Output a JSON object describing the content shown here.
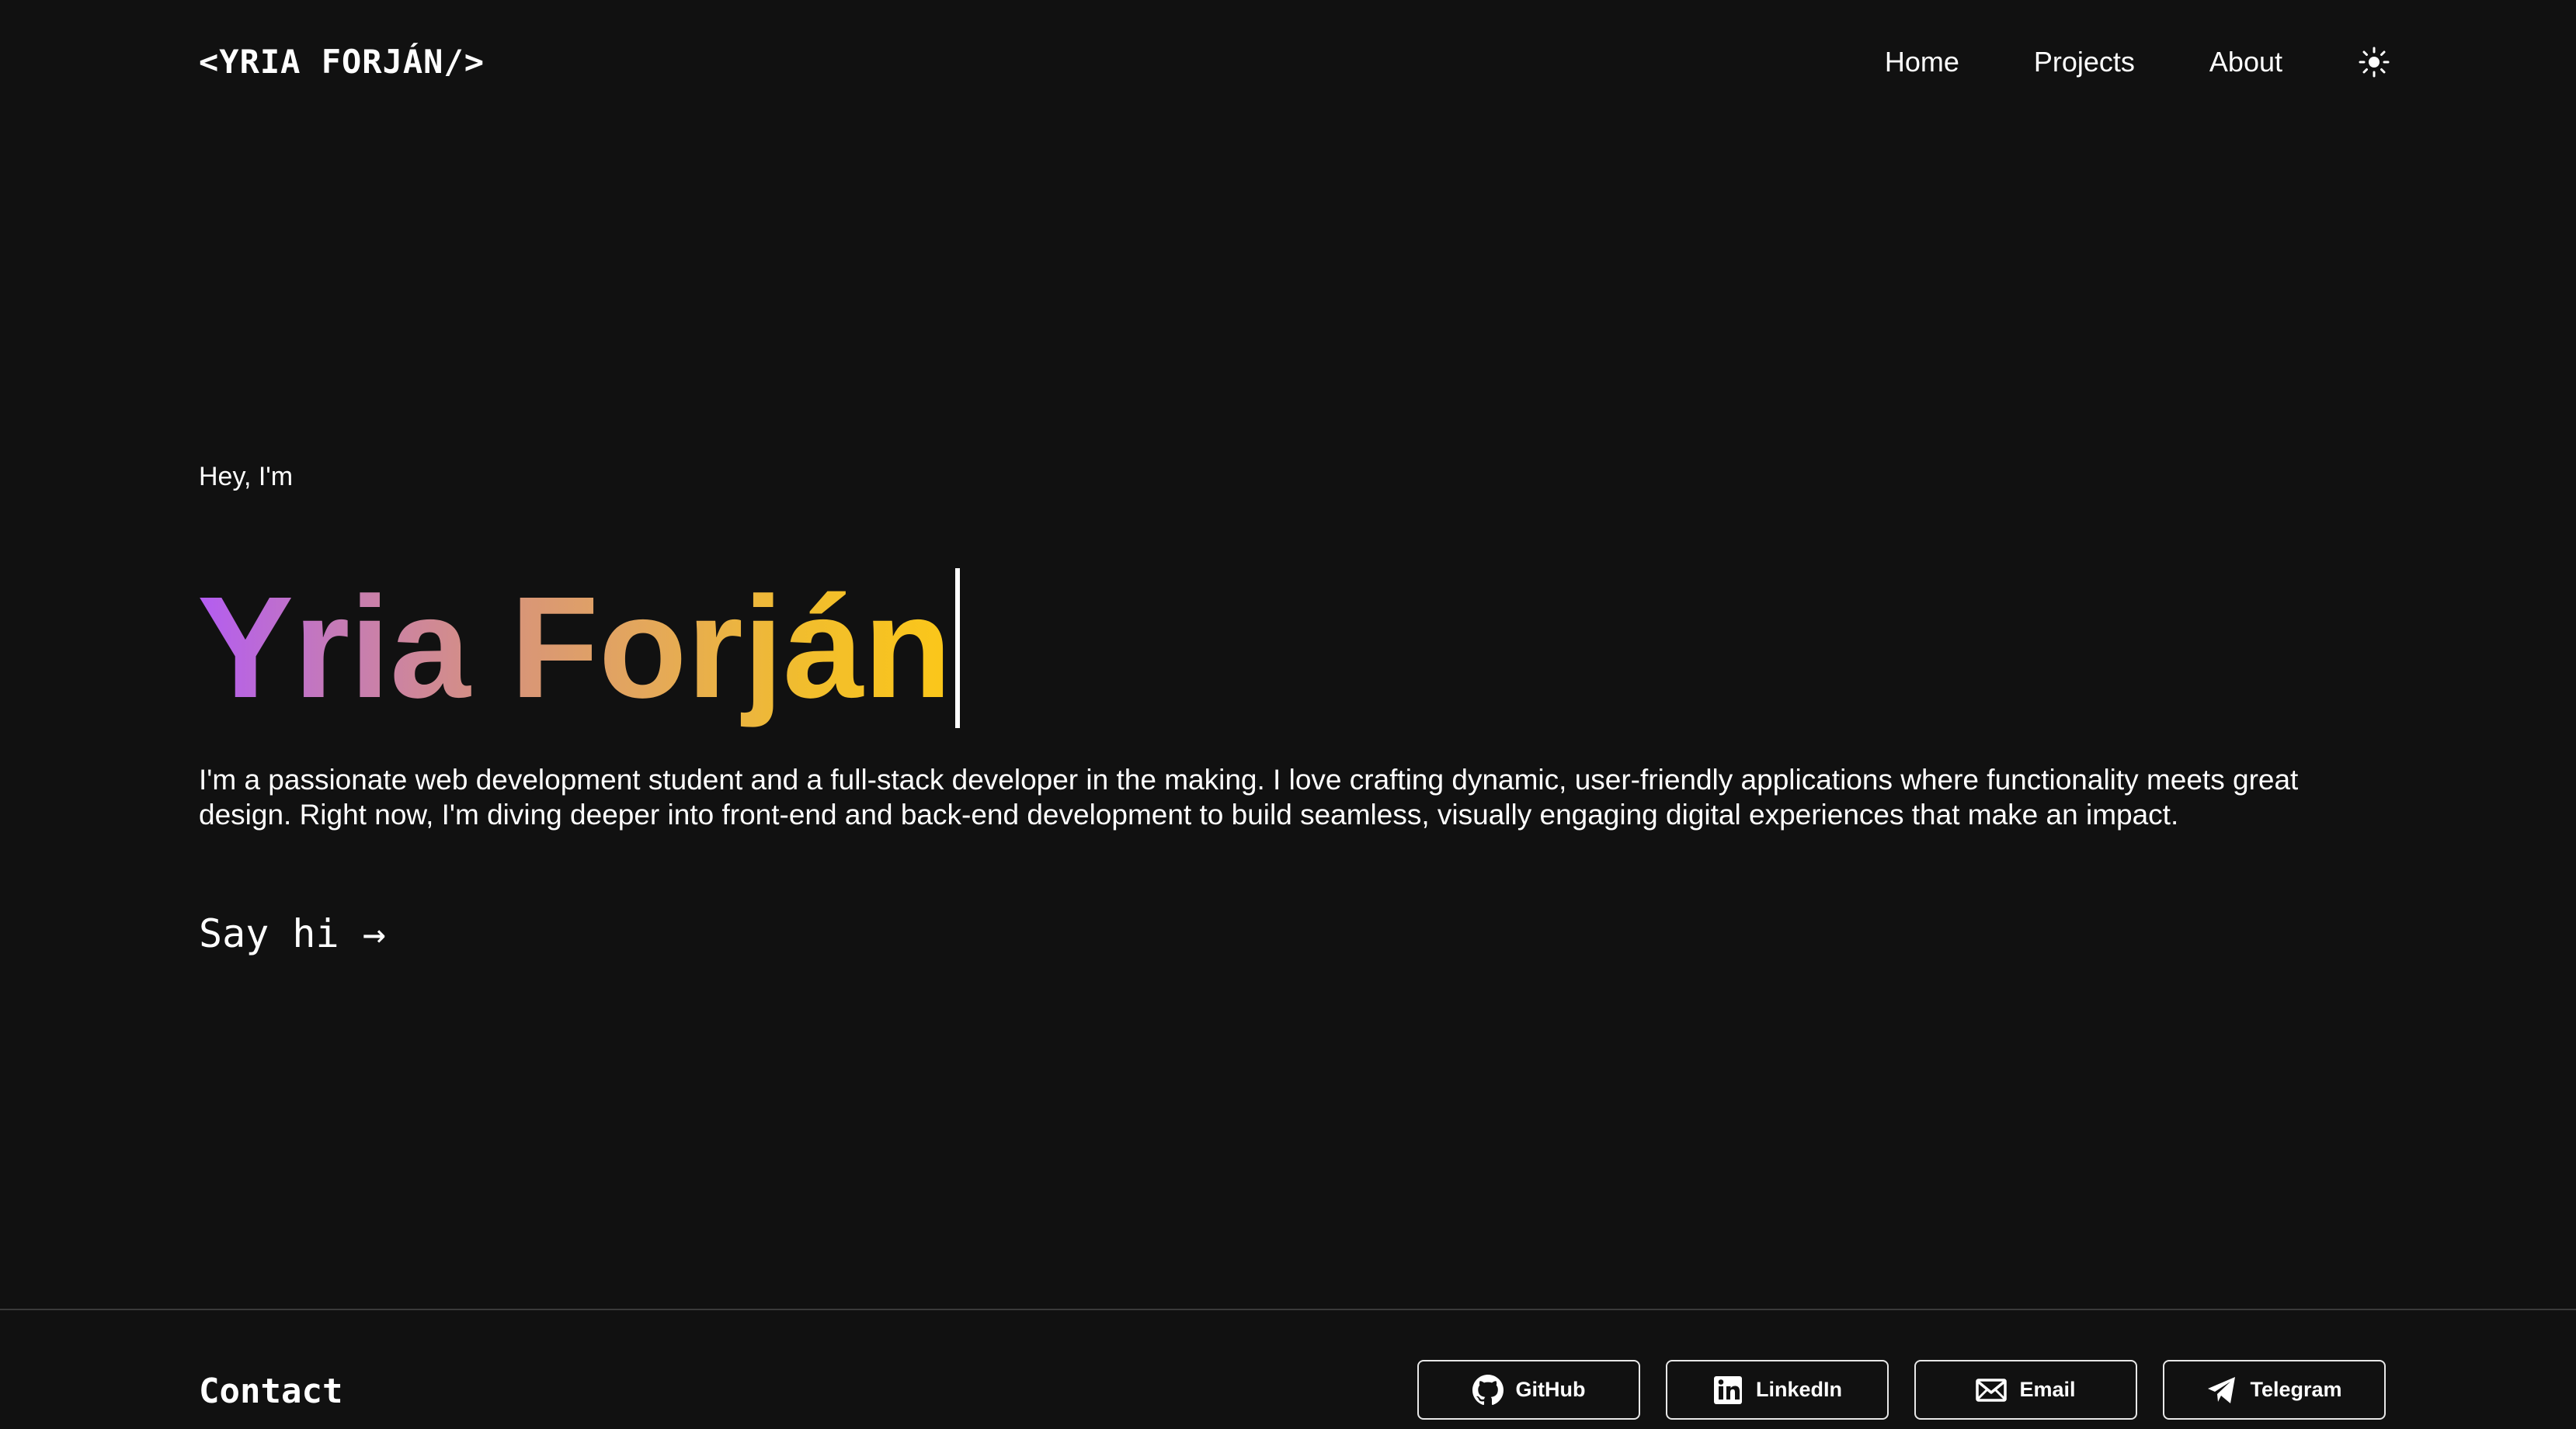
{
  "header": {
    "logo": "<YRIA FORJÁN/>",
    "nav": [
      {
        "label": "Home"
      },
      {
        "label": "Projects"
      },
      {
        "label": "About"
      }
    ],
    "theme_toggle_icon": "sun-icon"
  },
  "hero": {
    "greeting": "Hey, I'm",
    "name": "Yria Forján",
    "bio": "I'm a passionate web development student and a full-stack developer in the making. I love crafting dynamic, user-friendly applications where functionality meets great design. Right now, I'm diving deeper into front-end and back-end development to build seamless, visually engaging digital experiences that make an impact.",
    "cta": "Say hi →",
    "gradient_colors": [
      "#b35cf2",
      "#fbc719"
    ]
  },
  "footer": {
    "title": "Contact",
    "links": [
      {
        "label": "GitHub",
        "icon": "github-icon"
      },
      {
        "label": "LinkedIn",
        "icon": "linkedin-icon"
      },
      {
        "label": "Email",
        "icon": "email-icon"
      },
      {
        "label": "Telegram",
        "icon": "telegram-icon"
      }
    ]
  },
  "colors": {
    "background": "#111111",
    "text": "#ffffff"
  }
}
